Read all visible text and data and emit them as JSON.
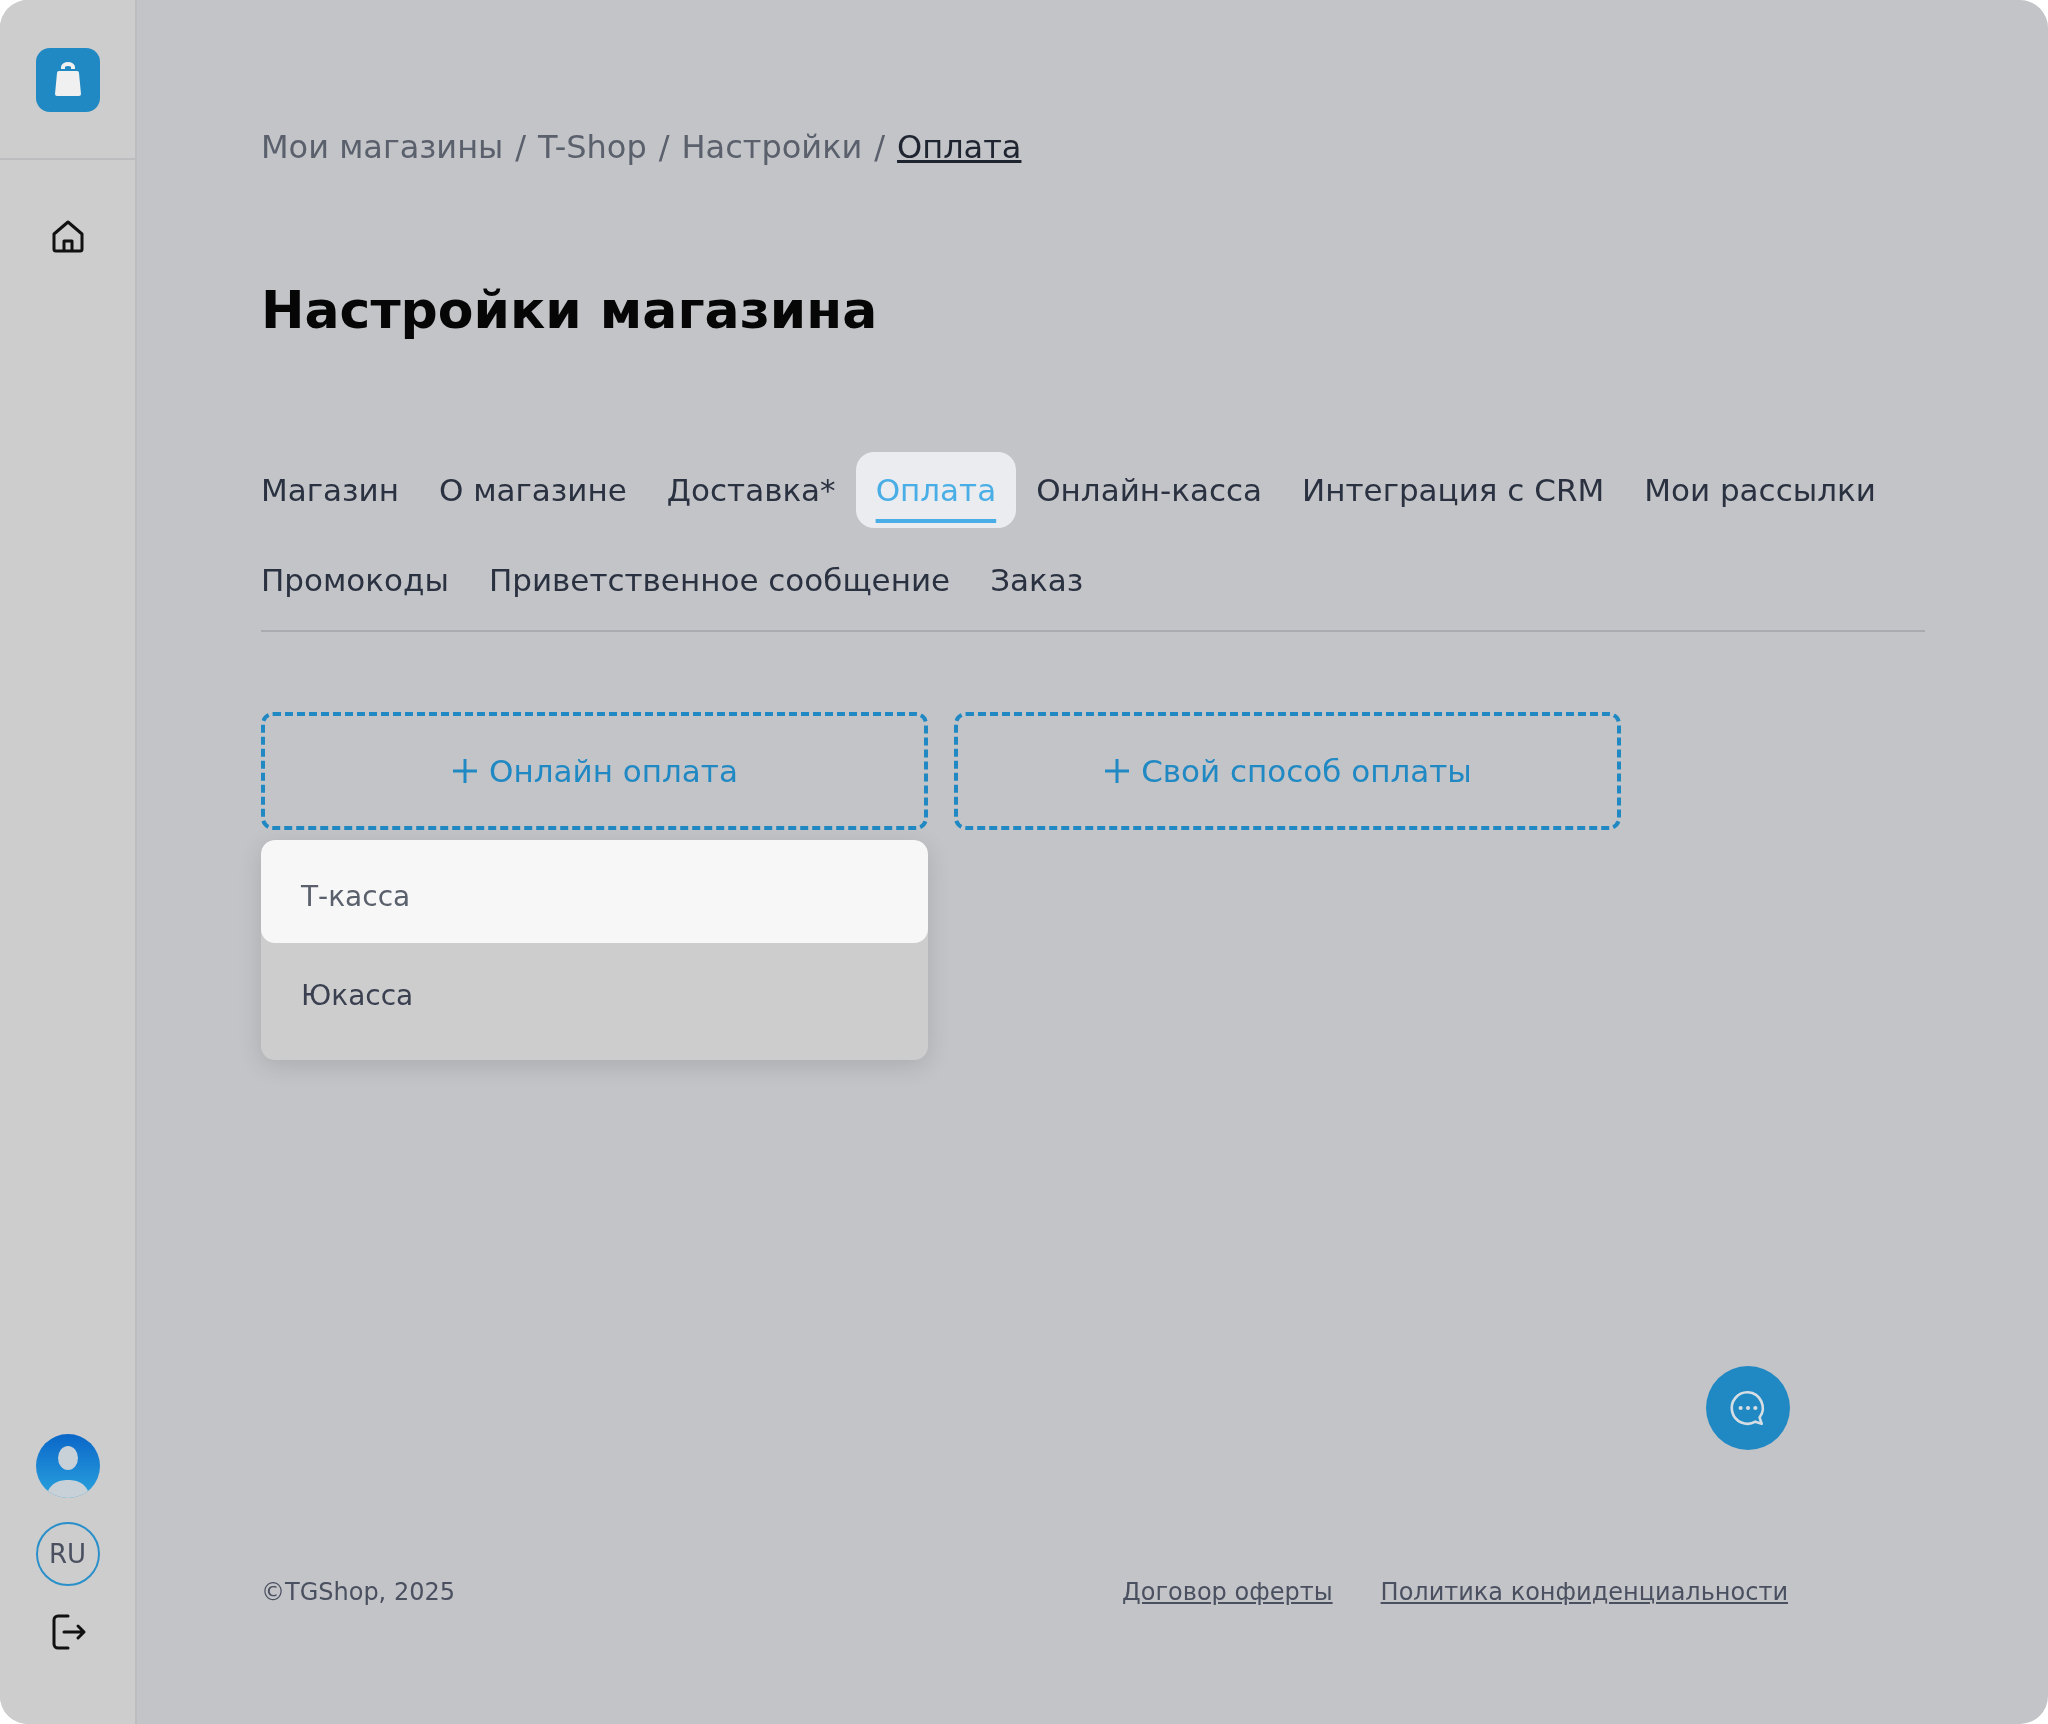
{
  "sidebar": {
    "language": "RU"
  },
  "breadcrumbs": [
    {
      "label": "Мои магазины",
      "current": false
    },
    {
      "label": "T-Shop",
      "current": false
    },
    {
      "label": "Настройки",
      "current": false
    },
    {
      "label": "Оплата",
      "current": true
    }
  ],
  "breadcrumb_separator": "/",
  "title": "Настройки магазина",
  "tabs": [
    {
      "label": "Магазин",
      "selected": false
    },
    {
      "label": "О магазине",
      "selected": false
    },
    {
      "label": "Доставка*",
      "selected": false
    },
    {
      "label": "Оплата",
      "selected": true
    },
    {
      "label": "Онлайн-касса",
      "selected": false
    },
    {
      "label": "Интеграция с CRM",
      "selected": false
    },
    {
      "label": "Мои рассылки",
      "selected": false
    },
    {
      "label": "Промокоды",
      "selected": false
    },
    {
      "label": "Приветственное сообщение",
      "selected": false
    },
    {
      "label": "Заказ",
      "selected": false
    }
  ],
  "add_buttons": [
    {
      "label": "Онлайн оплата"
    },
    {
      "label": "Свой способ оплаты"
    }
  ],
  "dropdown": {
    "items": [
      {
        "label": "Т-касса",
        "selected": true
      },
      {
        "label": "Юкасса",
        "selected": false
      }
    ]
  },
  "footer": {
    "copyright": "©TGShop, 2025",
    "links": [
      "Договор оферты",
      "Политика конфиденциальности"
    ]
  }
}
